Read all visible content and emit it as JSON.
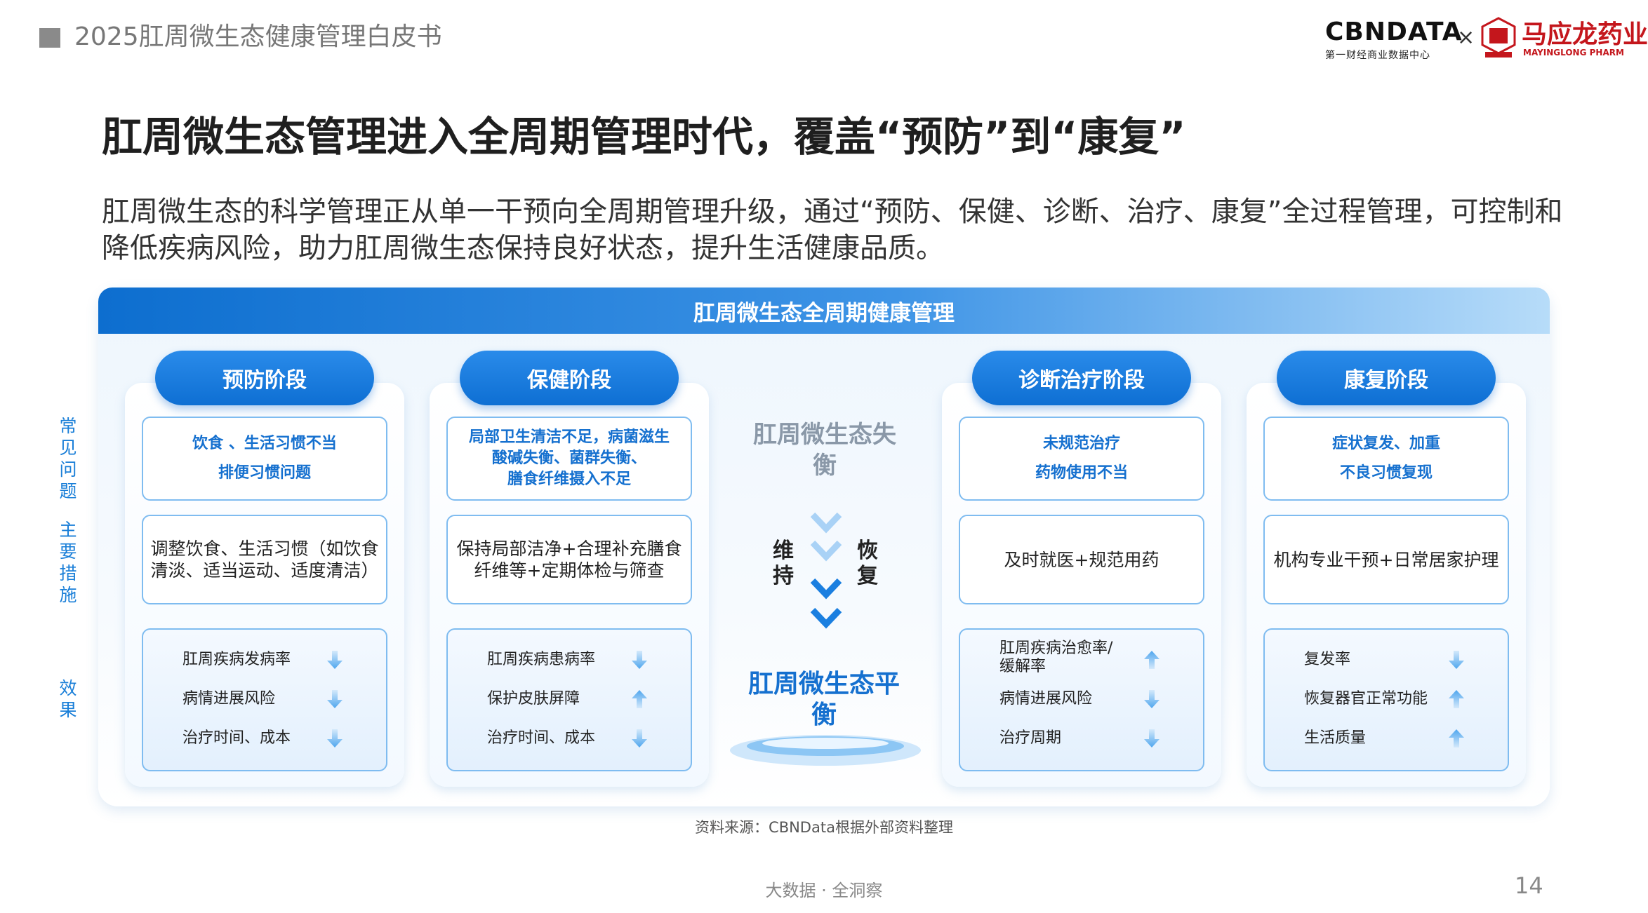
{
  "header": {
    "report_title": "2025肛周微生态健康管理白皮书",
    "logo_cbn": "CBNDATA",
    "logo_cbn_sub": "第一财经商业数据中心",
    "logo_times": "×",
    "logo_myl": "马应龙药业",
    "logo_myl_sub": "MAYINGLONG PHARM"
  },
  "main_title": "肛周微生态管理进入全周期管理时代，覆盖“预防”到“康复”",
  "subtitle": "肛周微生态的科学管理正从单一干预向全周期管理升级，通过“预防、保健、诊断、治疗、康复”全过程管理，可控制和降低疾病风险，助力肛周微生态保持良好状态，提升生活健康品质。",
  "panel_header": "肛周微生态全周期健康管理",
  "side_labels": {
    "problems": "常见问题",
    "measures": "主要措施",
    "effects": "效果"
  },
  "stages": [
    {
      "name": "预防阶段",
      "problems": [
        "饮食 、生活习惯不当",
        "排便习惯问题"
      ],
      "measure": "调整饮食、生活习惯（如饮食清淡、适当运动、适度清洁）",
      "effects": [
        {
          "label": "肛周疾病发病率",
          "trend": "down"
        },
        {
          "label": "病情进展风险",
          "trend": "down"
        },
        {
          "label": "治疗时间、成本",
          "trend": "down"
        }
      ]
    },
    {
      "name": "保健阶段",
      "problems": [
        "局部卫生清洁不足，病菌滋生",
        "酸碱失衡、菌群失衡、",
        "膳食纤维摄入不足"
      ],
      "measure": "保持局部洁净+合理补充膳食纤维等+定期体检与筛查",
      "effects": [
        {
          "label": "肛周疾病患病率",
          "trend": "down"
        },
        {
          "label": "保护皮肤屏障",
          "trend": "up"
        },
        {
          "label": "治疗时间、成本",
          "trend": "down"
        }
      ]
    },
    {
      "name": "诊断治疗阶段",
      "problems": [
        "未规范治疗",
        "药物使用不当"
      ],
      "measure": "及时就医+规范用药",
      "effects": [
        {
          "label": "肛周疾病治愈率/缓解率",
          "trend": "up"
        },
        {
          "label": "病情进展风险",
          "trend": "down"
        },
        {
          "label": "治疗周期",
          "trend": "down"
        }
      ]
    },
    {
      "name": "康复阶段",
      "problems": [
        "症状复发、加重",
        "不良习惯复现"
      ],
      "measure": "机构专业干预+日常居家护理",
      "effects": [
        {
          "label": "复发率",
          "trend": "down"
        },
        {
          "label": "恢复器官正常功能",
          "trend": "up"
        },
        {
          "label": "生活质量",
          "trend": "up"
        }
      ]
    }
  ],
  "center": {
    "imbalance": "肛周微生态失衡",
    "maintain": "维持",
    "recover": "恢复",
    "balance": "肛周微生态平衡"
  },
  "colors": {
    "primary_blue": "#0e6fd3",
    "light_blue": "#7fbcf0",
    "brand_red": "#c4161c"
  },
  "source": "资料来源：CBNData根据外部资料整理",
  "footer": "大数据 · 全洞察",
  "page_number": "14"
}
